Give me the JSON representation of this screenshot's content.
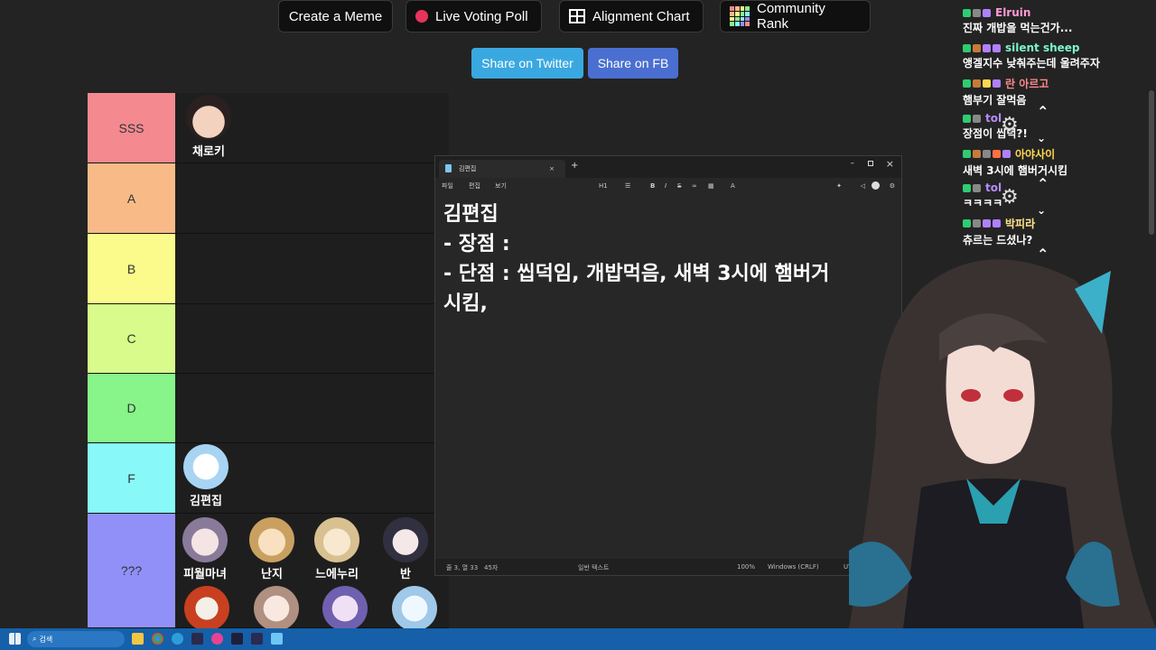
{
  "top_buttons": {
    "create_meme": "Create a Meme",
    "live_poll": "Live Voting Poll",
    "alignment_chart": "Alignment Chart",
    "community_rank": "Community Rank"
  },
  "share": {
    "twitter": "Share on Twitter",
    "fb": "Share on FB"
  },
  "tiers": [
    {
      "label": "SSS",
      "color": "#f48a90"
    },
    {
      "label": "A",
      "color": "#f8bb88"
    },
    {
      "label": "B",
      "color": "#fbfb8c"
    },
    {
      "label": "C",
      "color": "#d8fb8c"
    },
    {
      "label": "D",
      "color": "#88f58a"
    },
    {
      "label": "F",
      "color": "#88f8f8"
    },
    {
      "label": "???",
      "color": "#9090f8"
    }
  ],
  "characters": {
    "sss_1": "채로키",
    "f_1": "김편집",
    "q_1": "피월마녀",
    "q_2": "난지",
    "q_3": "느에누리",
    "q_4": "반"
  },
  "notepad": {
    "tab_title": "김편집",
    "menu": [
      "파일",
      "편집",
      "보기"
    ],
    "heading_label": "H1",
    "text": "김편집\n- 장점 :\n- 단점 : 씹덕임, 개밥먹음, 새벽 3시에 햄버거\n시킴, ",
    "status_position": "줄 3, 열 33",
    "status_chars": "45자",
    "status_format": "일반 텍스트",
    "status_zoom": "100%",
    "status_eol": "Windows (CRLF)",
    "status_encoding": "UTF-8"
  },
  "chat": [
    {
      "user": "Elruin",
      "color": "#ff9ad5",
      "msg": "진짜 개밥을 먹는건가..."
    },
    {
      "user": "silent sheep",
      "color": "#7df7c8",
      "msg": "앵겔지수 낮춰주는데 울려주자"
    },
    {
      "user": "란 아르고",
      "color": "#ff8a8a",
      "msg": "햄부기 잘먹음"
    },
    {
      "user": "tol",
      "color": "#b78cff",
      "msg": "장점이 씹덕?!"
    },
    {
      "user": "아야사이",
      "color": "#ffd84d",
      "msg": "새벽 3시에 햄버거시킴"
    },
    {
      "user": "tol",
      "color": "#b78cff",
      "msg": "ㅋㅋㅋㅋ"
    },
    {
      "user": "박피라",
      "color": "#ffe68a",
      "msg": "츄르는 드셨나?"
    }
  ],
  "taskbar": {
    "search_label": "검색"
  }
}
